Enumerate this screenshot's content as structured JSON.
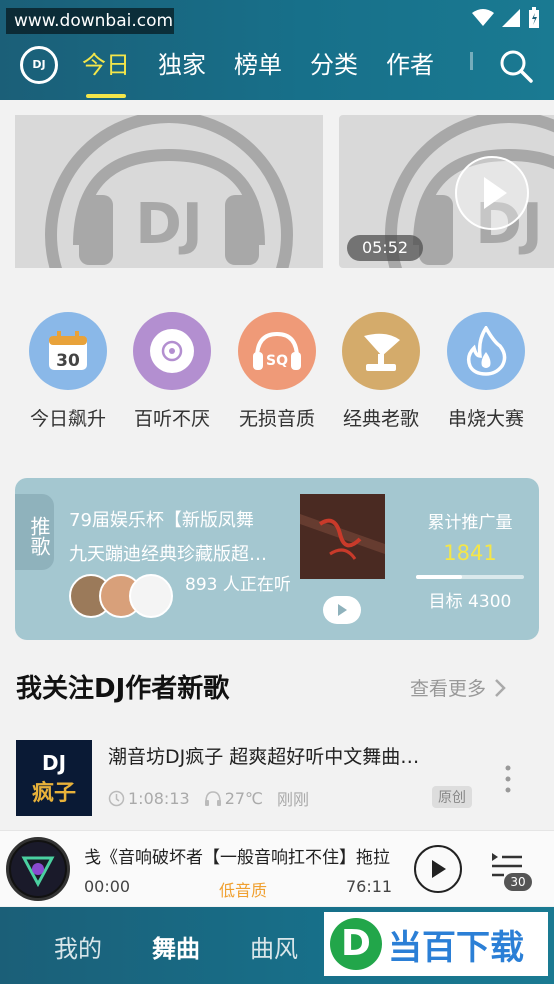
{
  "watermark": "www.downbai.com",
  "header": {
    "logo_text": "DJ",
    "tabs": [
      {
        "label": "今日",
        "active": true
      },
      {
        "label": "独家",
        "active": false
      },
      {
        "label": "榜单",
        "active": false
      },
      {
        "label": "分类",
        "active": false
      },
      {
        "label": "作者",
        "active": false
      }
    ],
    "search_icon": "search-icon"
  },
  "banner": {
    "left_label": "DJ",
    "right_label": "DJ",
    "duration": "05:52"
  },
  "categories": [
    {
      "label": "今日飙升",
      "icon": "calendar-30-icon",
      "icon_text": "30",
      "color": "#8ab8e8"
    },
    {
      "label": "百听不厌",
      "icon": "cd-disc-icon",
      "icon_text": "",
      "color": "#b38fd0"
    },
    {
      "label": "无损音质",
      "icon": "headphones-sq-icon",
      "icon_text": "SQ",
      "color": "#ef9a78"
    },
    {
      "label": "经典老歌",
      "icon": "gramophone-icon",
      "icon_text": "",
      "color": "#d4ab6b"
    },
    {
      "label": "串烧大赛",
      "icon": "flame-icon",
      "icon_text": "",
      "color": "#8ab8e8"
    }
  ],
  "recommend": {
    "tag": "推歌",
    "title_line1": "79届娱乐杯【新版凤舞",
    "title_line2": "九天蹦迪经典珍藏版超…",
    "listeners": "893 人正在听",
    "stats_label": "累计推广量",
    "stats_value": "1841",
    "progress": 0.43,
    "target": "目标 4300",
    "colors": {
      "card": "#a4c7d0",
      "value": "#f4e64a"
    }
  },
  "section": {
    "title": "我关注DJ作者新歌",
    "more": "查看更多"
  },
  "song": {
    "title": "潮音坊DJ疯子 超爽超好听中文舞曲…",
    "cover_text_top": "DJ",
    "cover_text_bottom": "疯子",
    "duration": "1:08:13",
    "temperature": "27℃",
    "time_ago": "刚刚",
    "badge": "原创"
  },
  "player": {
    "title": "戋《音响破坏者【一般音响扛不住】拖拉",
    "current_time": "00:00",
    "quality": "低音质",
    "total_time": "76:11",
    "playlist_count": "30"
  },
  "bottom_nav": [
    {
      "label": "我的",
      "active": false
    },
    {
      "label": "舞曲",
      "active": true
    },
    {
      "label": "曲风",
      "active": false
    }
  ],
  "brand_watermark": "当百下载"
}
